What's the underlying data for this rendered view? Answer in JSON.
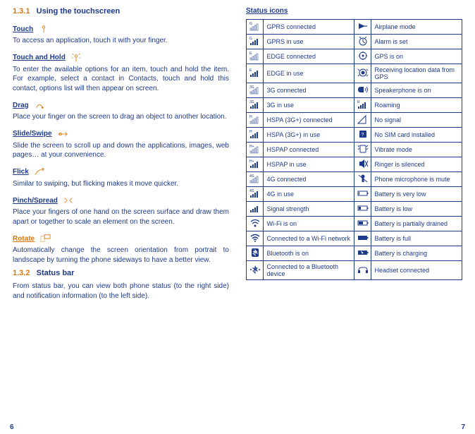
{
  "left": {
    "h1_num": "1.3.1",
    "h1_title": "Using the touchscreen",
    "touch_label": "Touch",
    "touch_text": "To access an application, touch it with your finger.",
    "toh_label": "Touch and Hold",
    "toh_text": "To enter the available options for an item, touch and hold the item. For example, select a contact in Contacts, touch and hold this contact, options list will then appear on screen.",
    "drag_label": "Drag",
    "drag_text": "Place your finger on the screen to drag an object to another location.",
    "slide_label": "Slide/Swipe",
    "slide_text": "Slide the screen to scroll up and down the applications, images, web pages… at your convenience.",
    "flick_label": "Flick",
    "flick_text": "Similar to swiping, but flicking makes it move quicker.",
    "pinch_label": "Pinch/Spread",
    "pinch_text": "Place your fingers of one hand on the screen surface and draw them apart or together to scale an element on the screen.",
    "rotate_label": "Rotate",
    "rotate_text": "Automatically change the screen orientation from portrait to landscape by turning the phone sideways to have a better view.",
    "h2_num": "1.3.2",
    "h2_title": "Status bar",
    "status_text": "From status bar, you can view both phone status (to the right side) and notification information (to the left side)."
  },
  "right": {
    "header": "Status icons",
    "rows": [
      {
        "l": "GPRS connected",
        "r": "Airplane mode"
      },
      {
        "l": "GPRS in use",
        "r": "Alarm is set"
      },
      {
        "l": "EDGE connected",
        "r": "GPS is on"
      },
      {
        "l": "EDGE in use",
        "r": "Receiving location data from GPS"
      },
      {
        "l": "3G connected",
        "r": "Speakerphone is on"
      },
      {
        "l": "3G in use",
        "r": "Roaming"
      },
      {
        "l": "HSPA (3G+) connected",
        "r": "No signal"
      },
      {
        "l": "HSPA (3G+) in use",
        "r": "No SIM card installed"
      },
      {
        "l": "HSPAP connected",
        "r": "Vibrate mode"
      },
      {
        "l": "HSPAP in use",
        "r": "Ringer is silenced"
      },
      {
        "l": "4G connected",
        "r": "Phone microphone is mute"
      },
      {
        "l": "4G in use",
        "r": "Battery is very low"
      },
      {
        "l": "Signal strength",
        "r": "Battery is low"
      },
      {
        "l": "Wi-Fi is on",
        "r": "Battery is partially drained"
      },
      {
        "l": "Connected to a Wi-Fi network",
        "r": "Battery is full"
      },
      {
        "l": "Bluetooth is on",
        "r": "Battery is charging"
      },
      {
        "l": "Connected to a Bluetooth device",
        "r": "Headset connected"
      }
    ],
    "left_icon_labels": [
      "G",
      "G",
      "E",
      "E",
      "3G",
      "3G",
      "H",
      "H",
      "H+",
      "H+",
      "4G",
      "4G",
      "",
      "",
      "",
      "",
      ""
    ]
  },
  "page_left": "6",
  "page_right": "7"
}
